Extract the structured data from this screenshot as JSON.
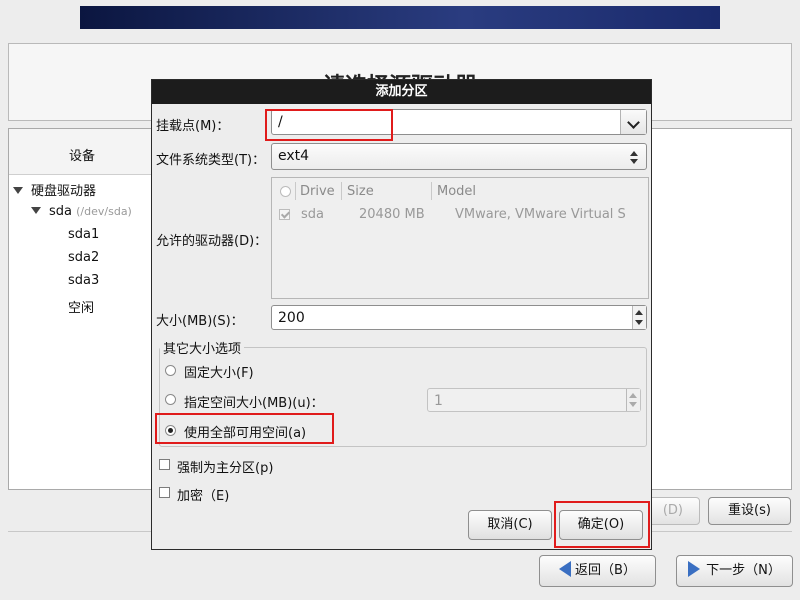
{
  "background": {
    "page_title": "请选择源驱动器",
    "tree_header": "设备",
    "tree": {
      "root": "硬盘驱动器",
      "disk": "sda",
      "disk_path": "(/dev/sda)",
      "partitions": [
        "sda1",
        "sda2",
        "sda3"
      ],
      "free": "空闲"
    },
    "buttons": {
      "delete_partial": "(D)",
      "reset": "重设(s)",
      "back": "返回（B）",
      "next": "下一步（N）"
    }
  },
  "dialog": {
    "title": "添加分区",
    "mount_point": {
      "label": "挂载点(M)：",
      "value": "/"
    },
    "fs_type": {
      "label": "文件系统类型(T)：",
      "value": "ext4"
    },
    "allowed_drives": {
      "label": "允许的驱动器(D)：",
      "columns": [
        "Drive",
        "Size",
        "Model"
      ],
      "rows": [
        {
          "drive": "sda",
          "size": "20480 MB",
          "model": "VMware, VMware Virtual S"
        }
      ]
    },
    "size": {
      "label": "大小(MB)(S)：",
      "value": "200"
    },
    "other_size_options": {
      "legend": "其它大小选项",
      "fixed": "固定大小(F)",
      "fill_upto": "指定空间大小(MB)(u)：",
      "fill_upto_value": "1",
      "fill_all": "使用全部可用空间(a)"
    },
    "force_primary": "强制为主分区(p)",
    "encrypt": "加密（E)",
    "cancel": "取消(C)",
    "ok": "确定(O)"
  },
  "colors": {
    "highlight": "#e01b1b",
    "titlebar": "#1c1c1c"
  }
}
